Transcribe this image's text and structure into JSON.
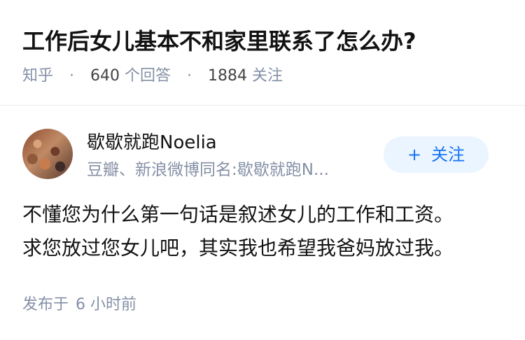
{
  "question": {
    "title": "工作后女儿基本不和家里联系了怎么办?",
    "source": "知乎",
    "separator": "·",
    "answers_count": "640",
    "answers_label": "个回答",
    "followers_count": "1884",
    "followers_label": "关注"
  },
  "answer": {
    "author": {
      "name": "歇歇就跑Noelia",
      "bio": "豆瓣、新浪微博同名:歇歇就跑N..."
    },
    "follow_button": {
      "icon": "+",
      "label": "关注"
    },
    "content": [
      "不懂您为什么第一句话是叙述女儿的工作和工资。",
      "求您放过您女儿吧，其实我也希望我爸妈放过我。"
    ],
    "published_label": "发布于",
    "published_time": "6 小时前"
  },
  "colors": {
    "title_text": "#121212",
    "meta_text": "#8590a6",
    "follow_button_bg": "#ebf5ff",
    "follow_button_text": "#1772f6",
    "divider": "#ebebeb"
  }
}
